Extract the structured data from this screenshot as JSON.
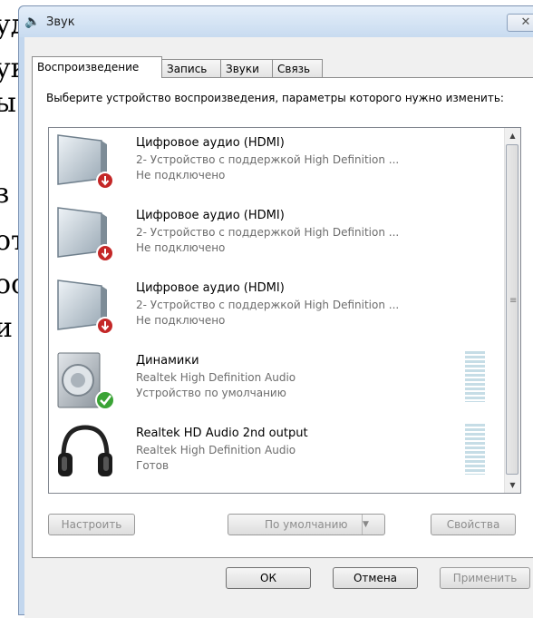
{
  "background_doc": {
    "lines": [
      "уд",
      "ук",
      "ы",
      "з",
      "от",
      "ос",
      "и"
    ]
  },
  "window": {
    "title": "Звук",
    "close_glyph": "✕"
  },
  "tabs": [
    {
      "label": "Воспроизведение",
      "active": true
    },
    {
      "label": "Запись",
      "active": false
    },
    {
      "label": "Звуки",
      "active": false
    },
    {
      "label": "Связь",
      "active": false
    }
  ],
  "instruction": "Выберите устройство воспроизведения, параметры которого нужно изменить:",
  "devices": [
    {
      "name": "Цифровое аудио (HDMI)",
      "description": "2- Устройство с поддержкой High Definition ...",
      "status": "Не подключено",
      "icon": "monitor-icon",
      "badge": "disconnected-badge-icon"
    },
    {
      "name": "Цифровое аудио (HDMI)",
      "description": "2- Устройство с поддержкой High Definition ...",
      "status": "Не подключено",
      "icon": "monitor-icon",
      "badge": "disconnected-badge-icon"
    },
    {
      "name": "Цифровое аудио (HDMI)",
      "description": "2- Устройство с поддержкой High Definition ...",
      "status": "Не подключено",
      "icon": "monitor-icon",
      "badge": "disconnected-badge-icon"
    },
    {
      "name": "Динамики",
      "description": "Realtek High Definition Audio",
      "status": "Устройство по умолчанию",
      "icon": "speaker-icon",
      "badge": "default-check-badge-icon"
    },
    {
      "name": "Realtek HD Audio 2nd output",
      "description": "Realtek High Definition Audio",
      "status": "Готов",
      "icon": "headphones-icon",
      "badge": ""
    }
  ],
  "buttons": {
    "configure": "Настроить",
    "set_default": "По умолчанию",
    "properties": "Свойства",
    "ok": "ОК",
    "cancel": "Отмена",
    "apply": "Применить"
  },
  "colors": {
    "panel_bg": "#ffffff",
    "frame": "#c3d7ee",
    "meter": "#c6dde6"
  }
}
